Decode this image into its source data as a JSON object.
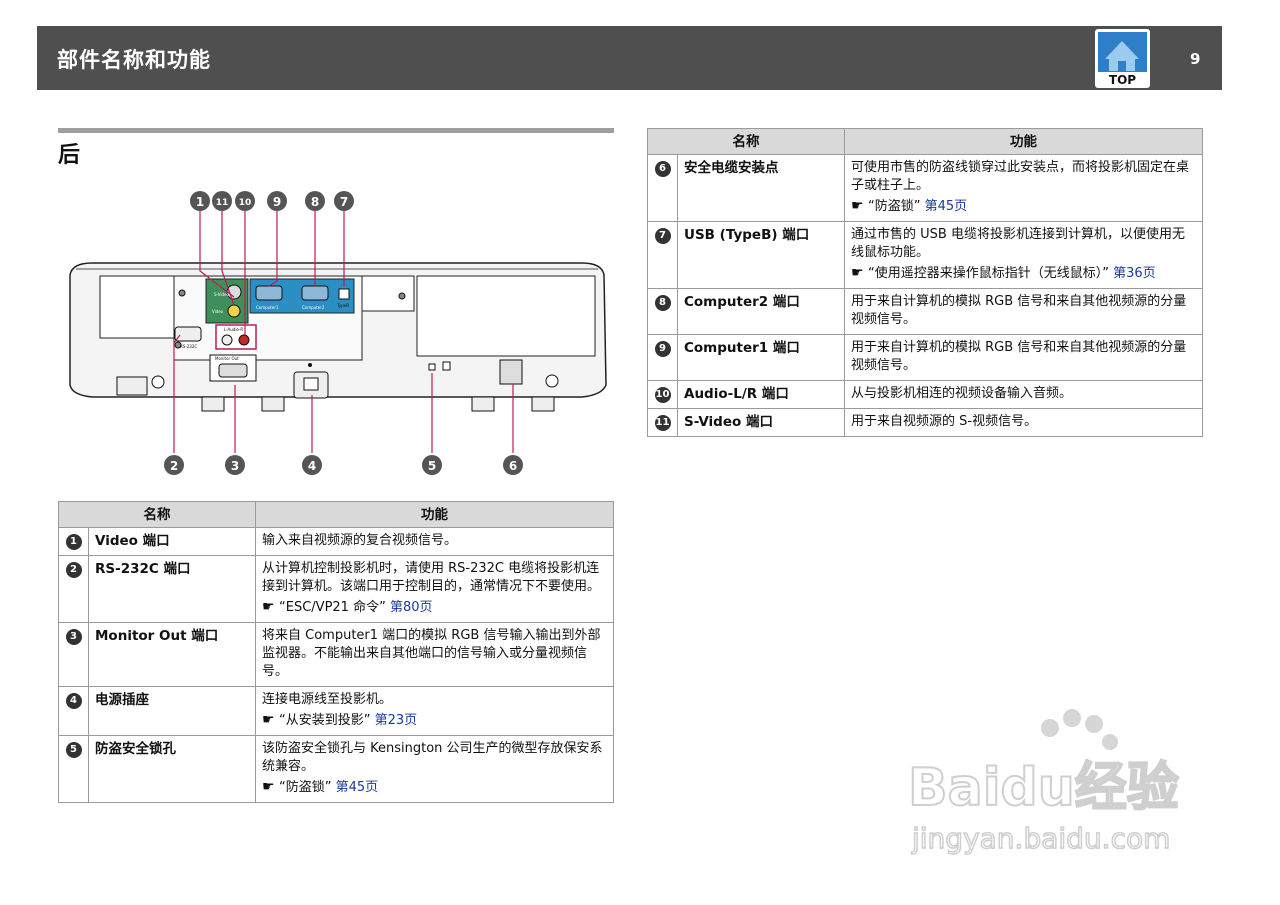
{
  "header": {
    "title": "部件名称和功能",
    "page_number": "9",
    "top_logo_text": "TOP"
  },
  "section": {
    "title": "后"
  },
  "diagram": {
    "callouts": [
      "1",
      "11",
      "10",
      "9",
      "8",
      "7",
      "2",
      "3",
      "4",
      "5",
      "6"
    ],
    "port_labels": {
      "svideo": "S-Video",
      "video": "Video",
      "computer1": "Computer1",
      "computer2": "Computer2",
      "typeb": "TypeB",
      "rs232c": "RS-232C",
      "audio": "L-Audio-R",
      "monitor_out": "Monitor Out"
    }
  },
  "table_left": {
    "headers": [
      "名称",
      "功能"
    ],
    "rows": [
      {
        "num": "1",
        "name": "Video 端口",
        "desc": "输入来自视频源的复合视频信号。",
        "ref": "",
        "ref_page": ""
      },
      {
        "num": "2",
        "name": "RS-232C 端口",
        "desc": "从计算机控制投影机时，请使用 RS-232C 电缆将投影机连接到计算机。该端口用于控制目的，通常情况下不要使用。",
        "ref": "“ESC/VP21 命令”",
        "ref_page": "第80页"
      },
      {
        "num": "3",
        "name": "Monitor Out 端口",
        "desc": "将来自 Computer1 端口的模拟 RGB 信号输入输出到外部监视器。不能输出来自其他端口的信号输入或分量视频信号。",
        "ref": "",
        "ref_page": ""
      },
      {
        "num": "4",
        "name": "电源插座",
        "desc": "连接电源线至投影机。",
        "ref": "“从安装到投影”",
        "ref_page": "第23页"
      },
      {
        "num": "5",
        "name": "防盗安全锁孔",
        "desc": "该防盗安全锁孔与 Kensington 公司生产的微型存放保安系统兼容。",
        "ref": "“防盗锁”",
        "ref_page": "第45页"
      }
    ]
  },
  "table_right": {
    "headers": [
      "名称",
      "功能"
    ],
    "rows": [
      {
        "num": "6",
        "name": "安全电缆安装点",
        "desc": "可使用市售的防盗线锁穿过此安装点，而将投影机固定在桌子或柱子上。",
        "ref": "“防盗锁”",
        "ref_page": "第45页"
      },
      {
        "num": "7",
        "name": "USB (TypeB) 端口",
        "desc": "通过市售的 USB 电缆将投影机连接到计算机，以便使用无线鼠标功能。",
        "ref": "“使用遥控器来操作鼠标指针（无线鼠标）”",
        "ref_page": "第36页"
      },
      {
        "num": "8",
        "name": "Computer2 端口",
        "desc": "用于来自计算机的模拟 RGB 信号和来自其他视频源的分量视频信号。",
        "ref": "",
        "ref_page": ""
      },
      {
        "num": "9",
        "name": "Computer1 端口",
        "desc": "用于来自计算机的模拟 RGB 信号和来自其他视频源的分量视频信号。",
        "ref": "",
        "ref_page": ""
      },
      {
        "num": "10",
        "name": "Audio-L/R 端口",
        "desc": "从与投影机相连的视频设备输入音频。",
        "ref": "",
        "ref_page": ""
      },
      {
        "num": "11",
        "name": "S-Video 端口",
        "desc": "用于来自视频源的 S-视频信号。",
        "ref": "",
        "ref_page": ""
      }
    ]
  },
  "watermark": {
    "brand": "Baidu经验",
    "url": "jingyan.baidu.com"
  },
  "colors": {
    "header_bg": "#4f4f4f",
    "callout_pink": "#c2185b",
    "link_blue": "#1a3a9a",
    "table_header_bg": "#d9d9d9"
  }
}
